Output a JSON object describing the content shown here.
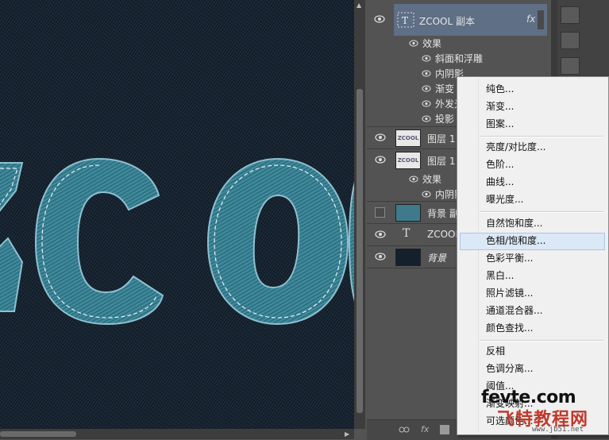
{
  "canvas": {
    "artwork_text": "ZCOO"
  },
  "layers": [
    {
      "name": "ZCOOL 副本",
      "fx": "fx",
      "thumb": "text",
      "selected": true
    },
    {
      "name": "图层 1",
      "thumb": "zcool"
    },
    {
      "name": "图层 1",
      "thumb": "zcool"
    },
    {
      "name": "背景 副",
      "thumb": "teal"
    },
    {
      "name": "ZCOOL",
      "thumb": "T"
    },
    {
      "name": "背景",
      "thumb": "dark"
    }
  ],
  "effects_group_1": {
    "header": "效果",
    "items": [
      "斜面和浮雕",
      "内阴影",
      "渐变",
      "外发光",
      "投影"
    ]
  },
  "effects_group_2": {
    "header": "效果",
    "items": [
      "内阴影"
    ]
  },
  "thumb_label": "ZCOOL",
  "context_menu": {
    "items": [
      "纯色...",
      "渐变...",
      "图案...",
      "亮度/对比度...",
      "色阶...",
      "曲线...",
      "曝光度...",
      "自然饱和度...",
      "色相/饱和度...",
      "色彩平衡...",
      "黑白...",
      "照片滤镜...",
      "通道混合器...",
      "颜色查找...",
      "反相",
      "色调分离...",
      "阈值...",
      "渐变映射...",
      "可选颜色..."
    ],
    "highlighted": "色相/饱和度..."
  },
  "footer": {
    "link_icon": "link-icon",
    "fx": "fx"
  },
  "watermark": {
    "line1": "fevte.com",
    "line2": "飞特教程网",
    "line3": "www.jb51.net"
  },
  "colors": {
    "canvas_bg": "#14202c",
    "letter_fill": "#3f8a9c",
    "panel_bg": "#535353",
    "menu_bg": "#f0f0f0",
    "highlight": "#dbe8f6"
  }
}
